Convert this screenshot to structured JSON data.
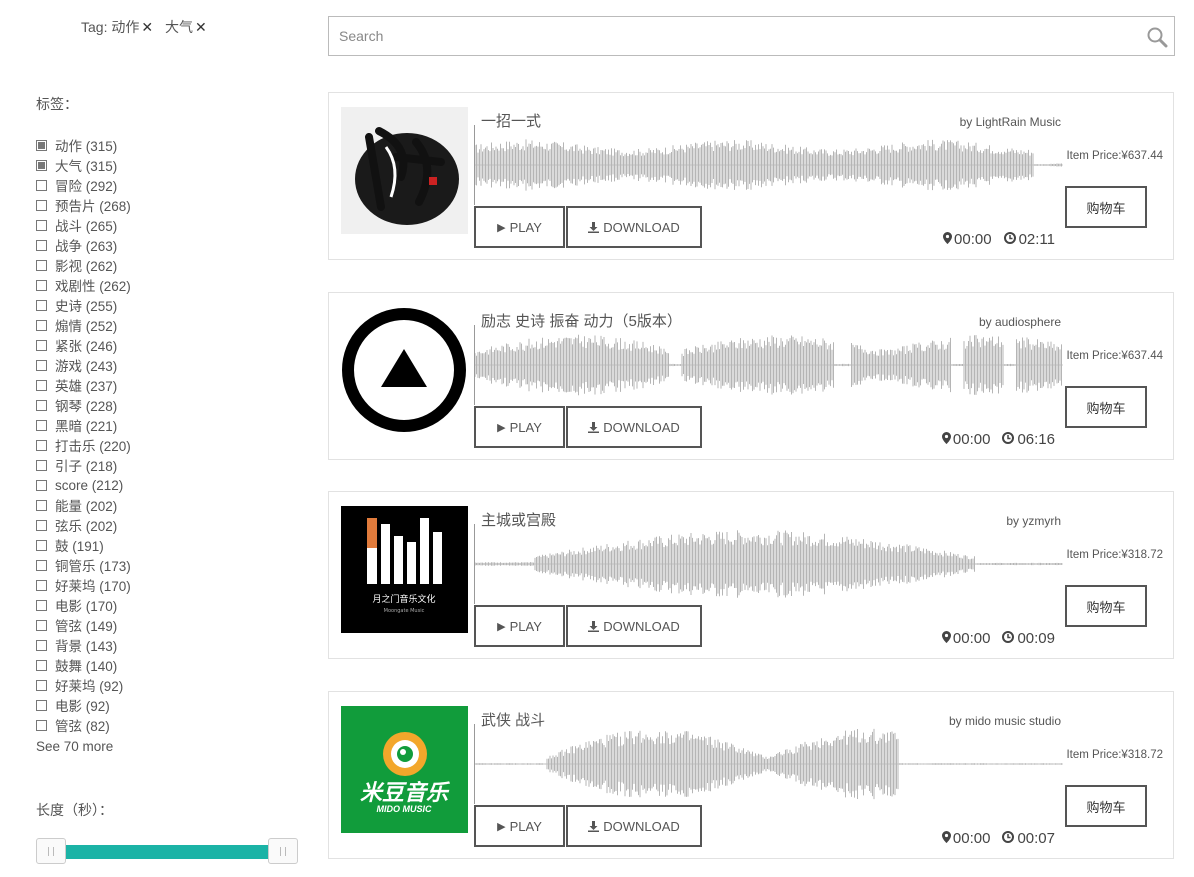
{
  "active_tags": {
    "prefix": "Tag:",
    "tags": [
      "动作",
      "大气"
    ],
    "remove_glyph": "✕"
  },
  "tags_label": "标签：",
  "filters": [
    {
      "label": "动作 (315)",
      "checked": true
    },
    {
      "label": "大气 (315)",
      "checked": true
    },
    {
      "label": "冒险 (292)",
      "checked": false
    },
    {
      "label": "预告片 (268)",
      "checked": false
    },
    {
      "label": "战斗 (265)",
      "checked": false
    },
    {
      "label": "战争 (263)",
      "checked": false
    },
    {
      "label": "影视 (262)",
      "checked": false
    },
    {
      "label": "戏剧性 (262)",
      "checked": false
    },
    {
      "label": "史诗 (255)",
      "checked": false
    },
    {
      "label": "煽情 (252)",
      "checked": false
    },
    {
      "label": "紧张 (246)",
      "checked": false
    },
    {
      "label": "游戏 (243)",
      "checked": false
    },
    {
      "label": "英雄 (237)",
      "checked": false
    },
    {
      "label": "钢琴 (228)",
      "checked": false
    },
    {
      "label": "黑暗 (221)",
      "checked": false
    },
    {
      "label": "打击乐 (220)",
      "checked": false
    },
    {
      "label": "引子 (218)",
      "checked": false
    },
    {
      "label": "score (212)",
      "checked": false
    },
    {
      "label": "能量 (202)",
      "checked": false
    },
    {
      "label": "弦乐 (202)",
      "checked": false
    },
    {
      "label": "鼓 (191)",
      "checked": false
    },
    {
      "label": "铜管乐 (173)",
      "checked": false
    },
    {
      "label": "好莱坞 (170)",
      "checked": false
    },
    {
      "label": "电影 (170)",
      "checked": false
    },
    {
      "label": "管弦 (149)",
      "checked": false
    },
    {
      "label": "背景 (143)",
      "checked": false
    },
    {
      "label": "鼓舞 (140)",
      "checked": false
    },
    {
      "label": "好莱坞 (92)",
      "checked": false
    },
    {
      "label": "电影 (92)",
      "checked": false
    },
    {
      "label": "管弦 (82)",
      "checked": false
    }
  ],
  "see_more": "See 70 more",
  "length_label": "长度（秒）：",
  "slider": {
    "low_fraction": 0,
    "high_fraction": 1
  },
  "search": {
    "placeholder": "Search"
  },
  "buttons": {
    "play": "PLAY",
    "download": "DOWNLOAD",
    "cart": "购物车"
  },
  "colors": {
    "accent": "#1bb3a6",
    "waveform": "#b5b5b5",
    "text": "#555555"
  },
  "tracks": [
    {
      "title": "一招一式",
      "by": "by LightRain Music",
      "price": "Item Price:¥637.44",
      "position": "00:00",
      "duration": "02:11",
      "cover": "ink-brush-logo",
      "wave": "dense"
    },
    {
      "title": "励志 史诗 振奋 动力（5版本）",
      "by": "by audiosphere",
      "price": "Item Price:¥637.44",
      "position": "00:00",
      "duration": "06:16",
      "cover": "play-triangle-circle",
      "wave": "segments"
    },
    {
      "title": "主城或宫殿",
      "by": "by yzmyrh",
      "price": "Item Price:¥318.72",
      "position": "00:00",
      "duration": "00:09",
      "cover": "moongate-music-logo",
      "wave": "swell"
    },
    {
      "title": "武侠 战斗",
      "by": "by mido music studio",
      "price": "Item Price:¥318.72",
      "position": "00:00",
      "duration": "00:07",
      "cover": "mido-music-logo",
      "wave": "burst"
    }
  ]
}
